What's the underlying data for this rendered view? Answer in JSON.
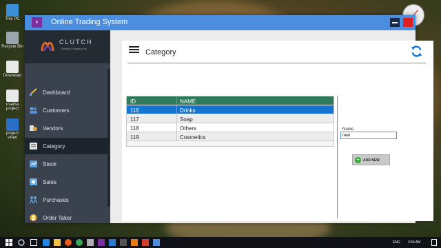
{
  "desktop": {
    "icons": [
      {
        "label": "This PC"
      },
      {
        "label": "Recycle Bin"
      },
      {
        "label": "Download"
      },
      {
        "label": "usama project"
      },
      {
        "label": "project video"
      }
    ]
  },
  "window": {
    "title": "Online Trading System",
    "badge": "›"
  },
  "logo": {
    "name": "CLUTCH",
    "tagline": "Trading Company Inc."
  },
  "sidebar": {
    "items": [
      {
        "label": "Dashboard",
        "icon": "dashboard-icon"
      },
      {
        "label": "Customers",
        "icon": "customers-icon"
      },
      {
        "label": "Vendors",
        "icon": "vendors-icon"
      },
      {
        "label": "Category",
        "icon": "category-icon",
        "active": true
      },
      {
        "label": "Stock",
        "icon": "stock-icon"
      },
      {
        "label": "Sales",
        "icon": "sales-icon"
      },
      {
        "label": "Purchases",
        "icon": "purchases-icon"
      },
      {
        "label": "Order Taker",
        "icon": "order-taker-icon"
      }
    ]
  },
  "page": {
    "title": "Category"
  },
  "grid": {
    "columns": [
      "ID",
      "NAME"
    ],
    "rows": [
      {
        "id": "116",
        "name": "Drinks",
        "selected": true
      },
      {
        "id": "117",
        "name": "Soap"
      },
      {
        "id": "118",
        "name": "Others"
      },
      {
        "id": "119",
        "name": "Cosmetics"
      }
    ]
  },
  "form": {
    "name_label": "Name",
    "name_value": "new",
    "add_button": "ADD NEW"
  },
  "taskbar": {
    "language": "ENG",
    "time": "2:54 AM"
  },
  "colors": {
    "titlebar": "#4b8ee0",
    "sidebar": "#3a424e",
    "grid_header": "#2f7a5a",
    "selected_row": "#1475d1"
  }
}
